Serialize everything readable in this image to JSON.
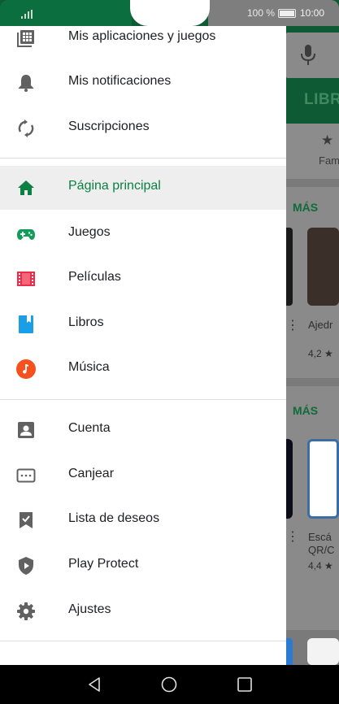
{
  "status_bar": {
    "battery_text": "100 %",
    "time": "10:00"
  },
  "drawer": {
    "top_items": [
      {
        "label": "Mis aplicaciones y juegos",
        "icon": "apps-grid-icon"
      },
      {
        "label": "Mis notificaciones",
        "icon": "bell-icon"
      },
      {
        "label": "Suscripciones",
        "icon": "refresh-icon"
      }
    ],
    "section_items": [
      {
        "label": "Página principal",
        "icon": "home-icon",
        "active": true
      },
      {
        "label": "Juegos",
        "icon": "gamepad-icon"
      },
      {
        "label": "Películas",
        "icon": "film-icon"
      },
      {
        "label": "Libros",
        "icon": "book-icon"
      },
      {
        "label": "Música",
        "icon": "music-icon"
      }
    ],
    "account_items": [
      {
        "label": "Cuenta",
        "icon": "account-icon"
      },
      {
        "label": "Canjear",
        "icon": "redeem-icon"
      },
      {
        "label": "Lista de deseos",
        "icon": "wishlist-icon"
      },
      {
        "label": "Play Protect",
        "icon": "play-protect-icon"
      },
      {
        "label": "Ajustes",
        "icon": "settings-icon"
      }
    ],
    "colors": {
      "active_text": "#0b8043",
      "active_bg": "#eeeeee"
    }
  },
  "background": {
    "tab_label": "LIBRO",
    "chip_label": "Fam",
    "more_label_1": "MÁS",
    "more_label_2": "MÁS",
    "card1_title": "Ajedr",
    "card1_rating": "4,2 ★",
    "card2_title_line1": "Escá",
    "card2_title_line2": "QR/C",
    "card2_rating": "4,4 ★"
  },
  "nav_bar": {
    "back": "back-icon",
    "home": "home-circle-icon",
    "recents": "recents-icon"
  }
}
